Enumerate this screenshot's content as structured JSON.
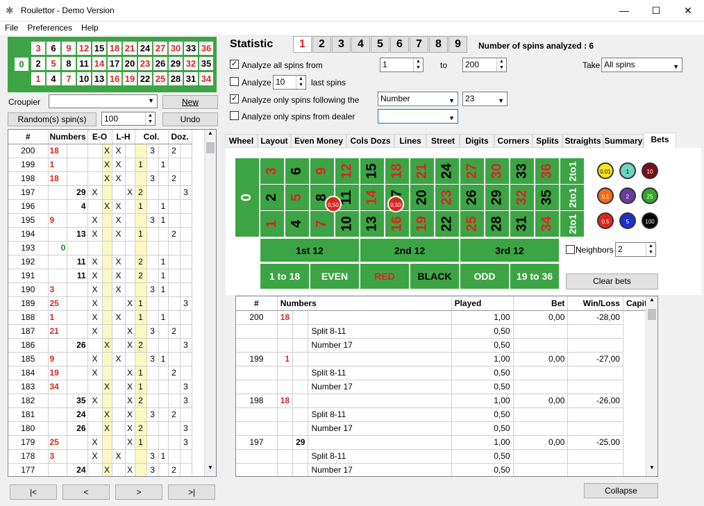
{
  "window": {
    "title": "Roulettor - Demo Version"
  },
  "menu": [
    "File",
    "Preferences",
    "Help"
  ],
  "mini": {
    "row3": [
      "3",
      "6",
      "9",
      "12",
      "15",
      "18",
      "21",
      "24",
      "27",
      "30",
      "33",
      "36"
    ],
    "row2": [
      "2",
      "5",
      "8",
      "11",
      "14",
      "17",
      "20",
      "23",
      "26",
      "29",
      "32",
      "35"
    ],
    "row1": [
      "1",
      "4",
      "7",
      "10",
      "13",
      "16",
      "19",
      "22",
      "25",
      "28",
      "31",
      "34"
    ],
    "zero": "0",
    "red": [
      "1",
      "3",
      "5",
      "7",
      "9",
      "12",
      "14",
      "16",
      "18",
      "19",
      "21",
      "23",
      "25",
      "27",
      "30",
      "32",
      "34",
      "36"
    ]
  },
  "croupier": {
    "label": "Croupier",
    "value": "",
    "new_label": "New"
  },
  "random": {
    "label": "Random(s) spin(s)",
    "value": "100",
    "undo": "Undo"
  },
  "history": {
    "headers": [
      "#",
      "Numbers",
      "E-O",
      "L-H",
      "Col.",
      "Doz."
    ],
    "rows": [
      [
        "200",
        "18",
        "",
        "",
        "X",
        "X",
        "",
        "",
        "3",
        "",
        "2",
        ""
      ],
      [
        "199",
        "1",
        "",
        "",
        "X",
        "X",
        "",
        "1",
        "",
        "1",
        "",
        ""
      ],
      [
        "198",
        "18",
        "",
        "",
        "X",
        "X",
        "",
        "",
        "3",
        "",
        "2",
        ""
      ],
      [
        "197",
        "",
        "29",
        "X",
        "",
        "",
        "X",
        "2",
        "",
        "",
        "",
        "3"
      ],
      [
        "196",
        "",
        "4",
        "",
        "X",
        "X",
        "",
        "1",
        "",
        "1",
        "",
        ""
      ],
      [
        "195",
        "9",
        "",
        "X",
        "",
        "X",
        "",
        "",
        "3",
        "1",
        "",
        ""
      ],
      [
        "194",
        "",
        "13",
        "X",
        "",
        "X",
        "",
        "1",
        "",
        "",
        "2",
        ""
      ],
      [
        "193",
        "0g",
        "",
        "",
        "",
        "",
        "",
        "",
        "",
        "",
        "",
        ""
      ],
      [
        "192",
        "",
        "11",
        "X",
        "",
        "X",
        "",
        "2",
        "",
        "1",
        "",
        ""
      ],
      [
        "191",
        "",
        "11",
        "X",
        "",
        "X",
        "",
        "2",
        "",
        "1",
        "",
        ""
      ],
      [
        "190",
        "3",
        "",
        "X",
        "",
        "X",
        "",
        "",
        "3",
        "1",
        "",
        ""
      ],
      [
        "189",
        "25",
        "",
        "X",
        "",
        "",
        "X",
        "1",
        "",
        "",
        "",
        "3"
      ],
      [
        "188",
        "1",
        "",
        "X",
        "",
        "X",
        "",
        "1",
        "",
        "1",
        "",
        ""
      ],
      [
        "187",
        "21",
        "",
        "X",
        "",
        "",
        "X",
        "",
        "3",
        "",
        "2",
        ""
      ],
      [
        "186",
        "",
        "26",
        "",
        "X",
        "",
        "X",
        "2",
        "",
        "",
        "",
        "3"
      ],
      [
        "185",
        "9",
        "",
        "X",
        "",
        "X",
        "",
        "",
        "3",
        "1",
        "",
        ""
      ],
      [
        "184",
        "19",
        "",
        "X",
        "",
        "",
        "X",
        "1",
        "",
        "",
        "2",
        ""
      ],
      [
        "183",
        "34",
        "",
        "",
        "X",
        "",
        "X",
        "1",
        "",
        "",
        "",
        "3"
      ],
      [
        "182",
        "",
        "35",
        "X",
        "",
        "",
        "X",
        "2",
        "",
        "",
        "",
        "3"
      ],
      [
        "181",
        "",
        "24",
        "",
        "X",
        "",
        "X",
        "",
        "3",
        "",
        "2",
        ""
      ],
      [
        "180",
        "",
        "26",
        "",
        "X",
        "",
        "X",
        "2",
        "",
        "",
        "",
        "3"
      ],
      [
        "179",
        "25",
        "",
        "X",
        "",
        "",
        "X",
        "1",
        "",
        "",
        "",
        "3"
      ],
      [
        "178",
        "3",
        "",
        "X",
        "",
        "X",
        "",
        "",
        "3",
        "1",
        "",
        ""
      ],
      [
        "177",
        "",
        "24",
        "",
        "X",
        "",
        "X",
        "",
        "3",
        "",
        "2",
        ""
      ]
    ]
  },
  "nav": [
    "|<",
    "<",
    ">",
    ">|"
  ],
  "statistic": {
    "label": "Statistic",
    "buttons": [
      "1",
      "2",
      "3",
      "4",
      "5",
      "6",
      "7",
      "8",
      "9"
    ],
    "spins": "Number of spins analyzed : 6"
  },
  "options": {
    "all_spins": "Analyze all spins from",
    "from": "1",
    "to_label": "to",
    "to": "200",
    "take_label": "Take",
    "take": "All spins",
    "analyze": "Analyze",
    "last_n": "10",
    "last_spins": "last spins",
    "following": "Analyze only spins following the",
    "following_type": "Number",
    "following_value": "23",
    "dealer": "Analyze only spins from dealer",
    "dealer_value": ""
  },
  "tabs": [
    "Wheel",
    "Layout",
    "Even Money",
    "Cols Dozs",
    "Lines",
    "Street",
    "Digits",
    "Corners",
    "Splits",
    "Straights",
    "Summary",
    "Bets"
  ],
  "board": {
    "dozens": [
      "1st 12",
      "2nd 12",
      "3rd 12"
    ],
    "outside": [
      "1 to 18",
      "EVEN",
      "RED",
      "BLACK",
      "ODD",
      "19 to 36"
    ],
    "col": "2to1",
    "chips": [
      "0.01",
      "1",
      "10",
      "0.1",
      "2",
      "25",
      "0.5",
      "5",
      "100"
    ],
    "placed_chip": "0,50",
    "neighbors_label": "Neighbors",
    "neighbors_value": "2",
    "clear": "Clear bets"
  },
  "bets": {
    "headers": [
      "#",
      "Numbers",
      "Played",
      "Bet",
      "Win/Loss",
      "Capital"
    ],
    "rows": [
      [
        "200",
        "18",
        "",
        "",
        "1,00",
        "0,00",
        "-28,00"
      ],
      [
        "",
        "",
        "",
        "Split 8-11",
        "0,50",
        "",
        ""
      ],
      [
        "",
        "",
        "",
        "Number 17",
        "0,50",
        "",
        ""
      ],
      [
        "199",
        "1",
        "",
        "",
        "1,00",
        "0,00",
        "-27,00"
      ],
      [
        "",
        "",
        "",
        "Split 8-11",
        "0,50",
        "",
        ""
      ],
      [
        "",
        "",
        "",
        "Number 17",
        "0,50",
        "",
        ""
      ],
      [
        "198",
        "18",
        "",
        "",
        "1,00",
        "0,00",
        "-26,00"
      ],
      [
        "",
        "",
        "",
        "Split 8-11",
        "0,50",
        "",
        ""
      ],
      [
        "",
        "",
        "",
        "Number 17",
        "0,50",
        "",
        ""
      ],
      [
        "197",
        "",
        "29",
        "",
        "1,00",
        "0,00",
        "-25,00"
      ],
      [
        "",
        "",
        "",
        "Split 8-11",
        "0,50",
        "",
        ""
      ],
      [
        "",
        "",
        "",
        "Number 17",
        "0,50",
        "",
        ""
      ]
    ]
  },
  "collapse": "Collapse"
}
